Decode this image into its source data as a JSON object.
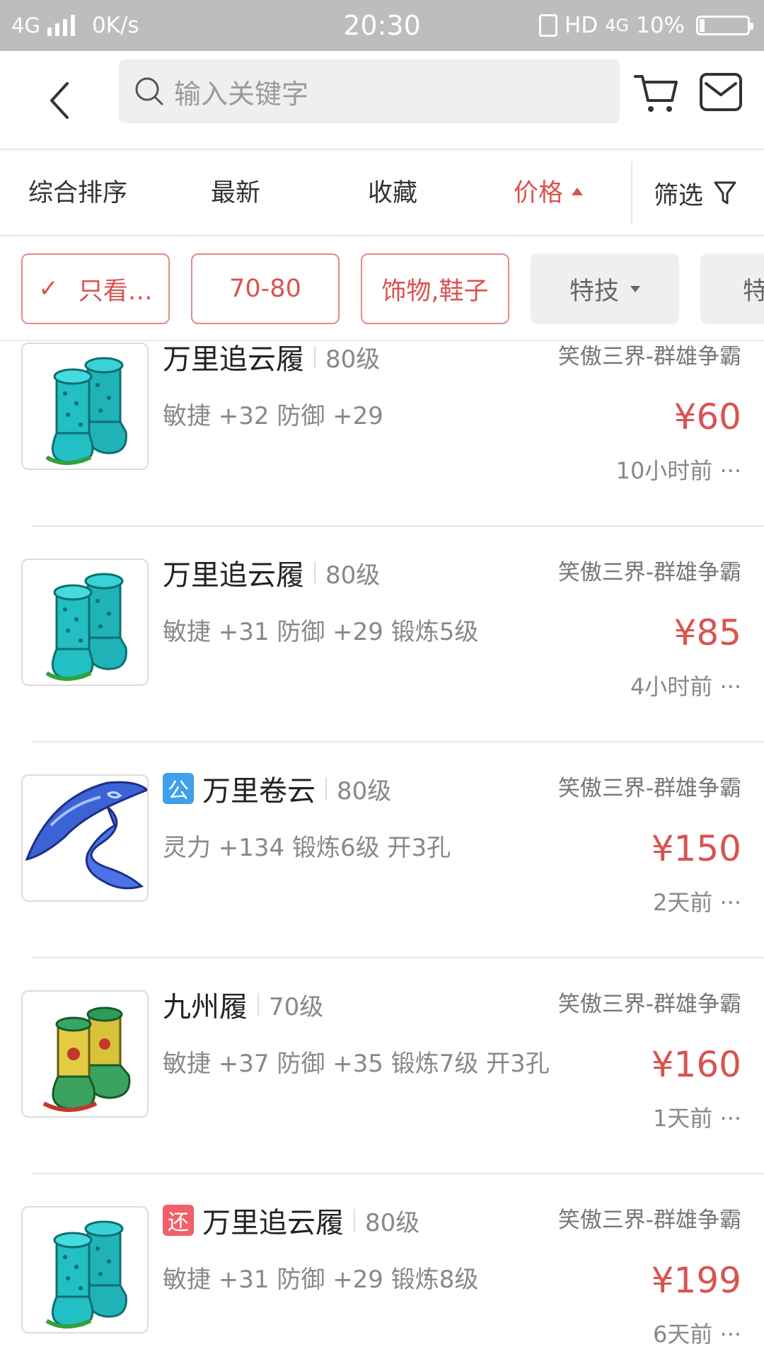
{
  "status_bar": {
    "network": "4G",
    "speed": "0K/s",
    "time": "20:30",
    "hd": "HD",
    "net_right": "4G",
    "battery": "10%",
    "battery_level": 0.1
  },
  "header": {
    "search_placeholder": "输入关键字",
    "icons": [
      "back-icon",
      "search-icon",
      "cart-icon",
      "mail-icon"
    ]
  },
  "sort_bar": {
    "items": [
      {
        "label": "综合排序",
        "active": false
      },
      {
        "label": "最新",
        "active": false
      },
      {
        "label": "收藏",
        "active": false
      },
      {
        "label": "价格",
        "active": true
      }
    ],
    "filter_label": "筛选"
  },
  "chips": [
    {
      "label": "只看…",
      "checked": true,
      "selected": true
    },
    {
      "label": "70-80",
      "selected": true
    },
    {
      "label": "饰物,鞋子",
      "selected": true
    },
    {
      "label": "特技",
      "selected": false,
      "dropdown": true
    },
    {
      "label": "特",
      "selected": false
    }
  ],
  "items": [
    {
      "name": "万里追云履",
      "badge": "",
      "level": "80级",
      "server": "笑傲三界-群雄争霸",
      "attrs": "敏捷 +32 防御 +29",
      "price": "¥60",
      "time": "10小时前 ···",
      "image": "teal-boots"
    },
    {
      "name": "万里追云履",
      "badge": "",
      "level": "80级",
      "server": "笑傲三界-群雄争霸",
      "attrs": "敏捷 +31 防御 +29 锻炼5级",
      "price": "¥85",
      "time": "4小时前 ···",
      "image": "teal-boots"
    },
    {
      "name": "万里卷云",
      "badge": "公",
      "level": "80级",
      "server": "笑傲三界-群雄争霸",
      "attrs": "灵力 +134 锻炼6级 开3孔",
      "price": "¥150",
      "time": "2天前 ···",
      "image": "blue-ribbon"
    },
    {
      "name": "九州履",
      "badge": "",
      "level": "70级",
      "server": "笑傲三界-群雄争霸",
      "attrs": "敏捷 +37 防御 +35 锻炼7级 开3孔",
      "price": "¥160",
      "time": "1天前 ···",
      "image": "jiuzhou-boots"
    },
    {
      "name": "万里追云履",
      "badge": "还",
      "level": "80级",
      "server": "笑傲三界-群雄争霸",
      "attrs": "敏捷 +31 防御 +29 锻炼8级",
      "price": "¥199",
      "time": "6天前 ···",
      "image": "teal-boots"
    }
  ],
  "colors": {
    "accent": "#d9534f",
    "status_bar": "#bdbdbd",
    "badge_gong": "#3da1ee",
    "badge_huan": "#f0606a"
  }
}
